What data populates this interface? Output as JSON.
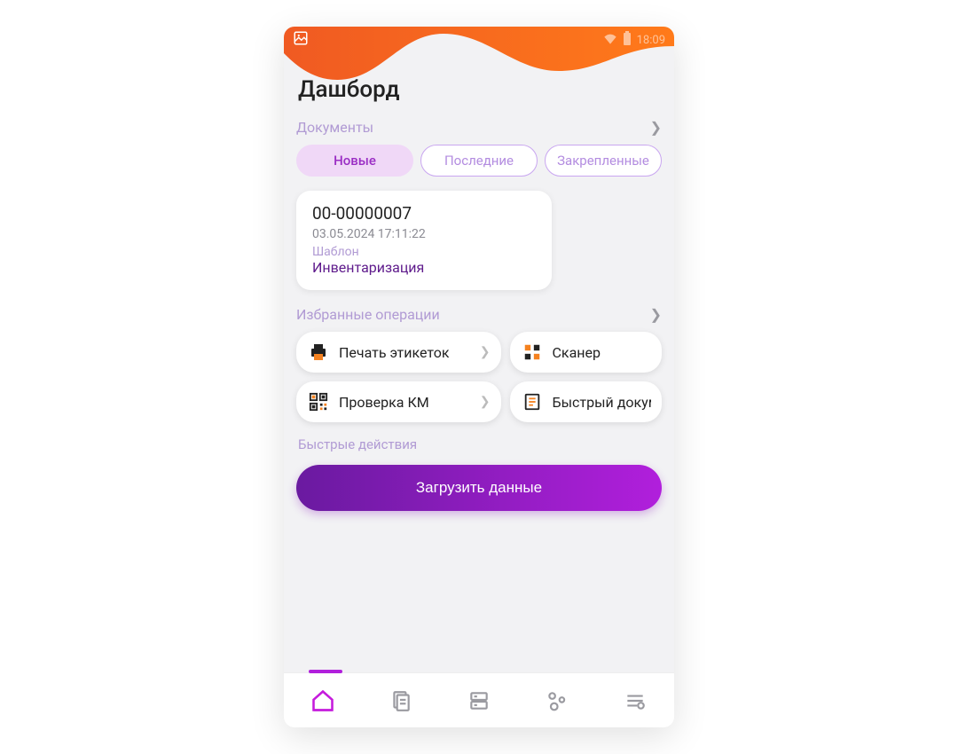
{
  "status": {
    "time": "18:09"
  },
  "title": "Дашборд",
  "sections": {
    "documents": "Документы",
    "favorites": "Избранные операции",
    "quick": "Быстрые действия"
  },
  "tabs": [
    {
      "label": "Новые",
      "active": true
    },
    {
      "label": "Последние",
      "active": false
    },
    {
      "label": "Закрепленные",
      "active": false
    }
  ],
  "document": {
    "number": "00-00000007",
    "datetime": "03.05.2024 17:11:22",
    "template_label": "Шаблон",
    "template_name": "Инвентаризация"
  },
  "favorites": [
    {
      "label": "Печать этикеток",
      "icon": "printer"
    },
    {
      "label": "Сканер",
      "icon": "scanner"
    },
    {
      "label": "Проверка КМ",
      "icon": "qr"
    },
    {
      "label": "Быстрый документ",
      "icon": "doc"
    }
  ],
  "load_button": "Загрузить данные",
  "nav": [
    "home",
    "documents",
    "storage",
    "operations",
    "settings"
  ]
}
